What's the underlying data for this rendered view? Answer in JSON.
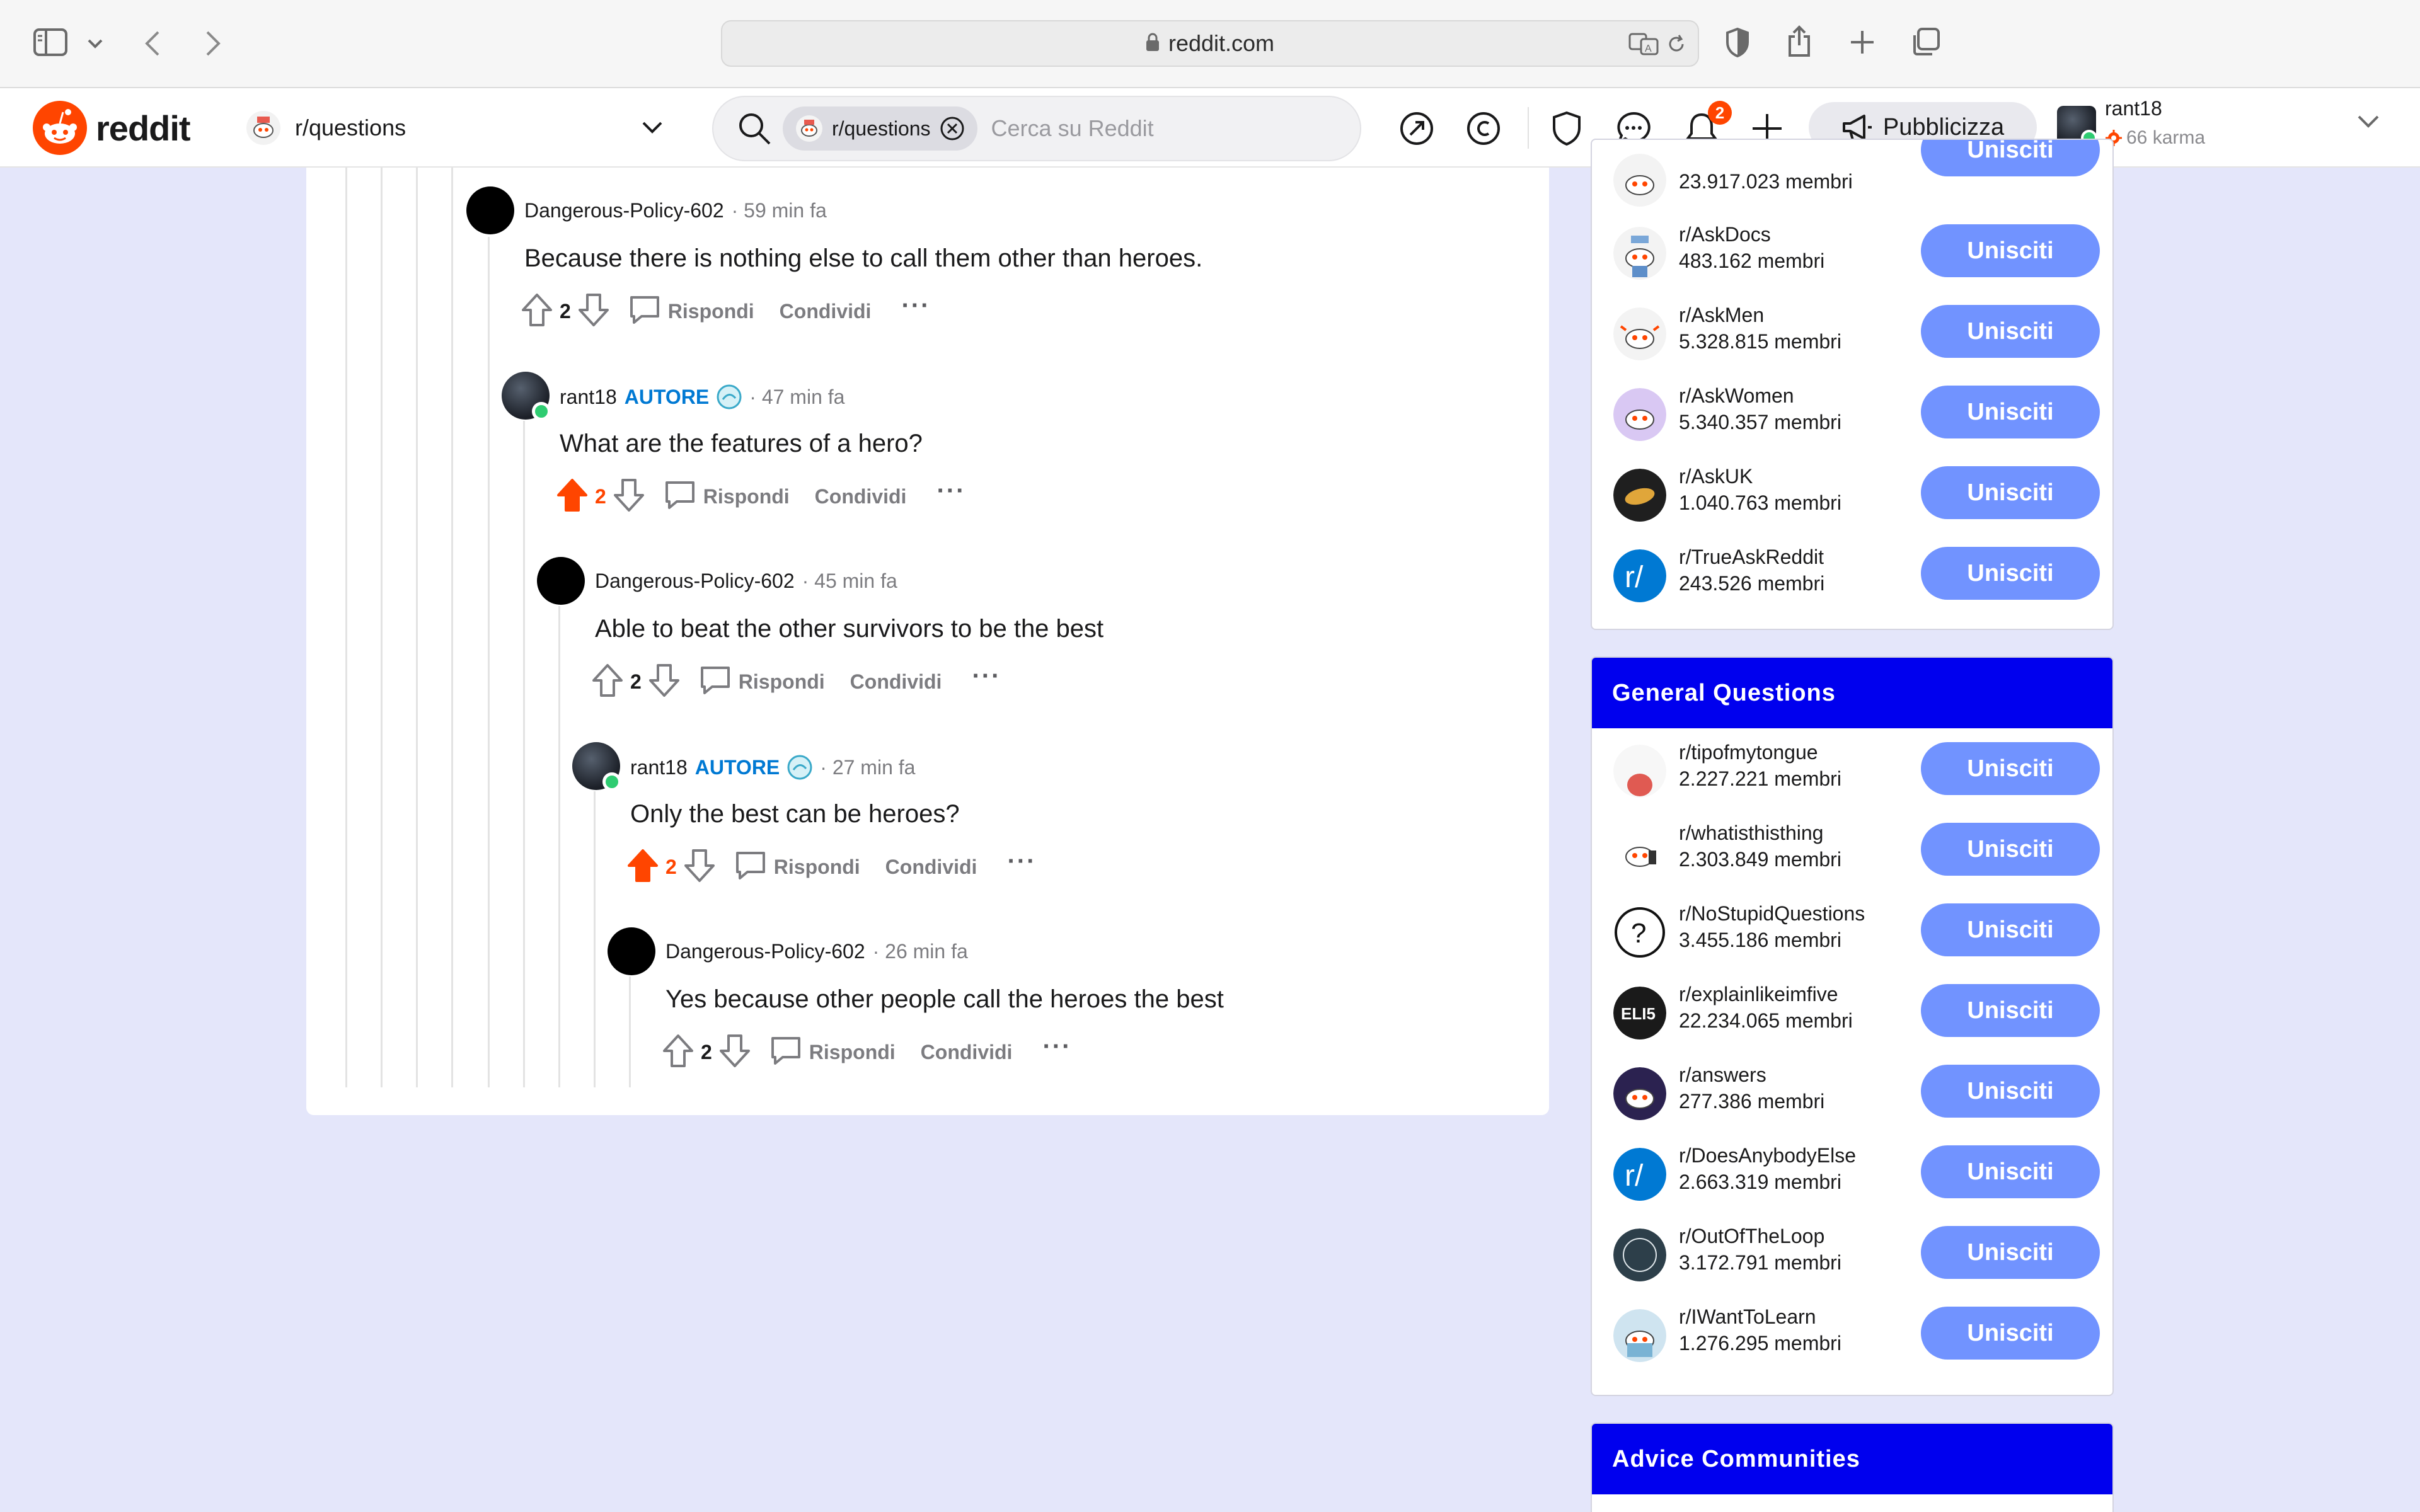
{
  "browser": {
    "url": "reddit.com"
  },
  "header": {
    "wordmark": "reddit",
    "community": "r/questions",
    "search_chip": "r/questions",
    "search_placeholder": "Cerca su Reddit",
    "notifications_count": "2",
    "advertise_label": "Pubblicizza",
    "user_name": "rant18",
    "user_karma": "66 karma"
  },
  "comments": [
    {
      "author": "Dangerous-Policy-602",
      "op": "",
      "time": "· 59 min fa",
      "body": "Because there is nothing else to call them other than heroes.",
      "votes": "2",
      "upvoted": false
    },
    {
      "author": "rant18",
      "op": "AUTORE",
      "time": "· 47 min fa",
      "body": "What are the features of a hero?",
      "votes": "2",
      "upvoted": true
    },
    {
      "author": "Dangerous-Policy-602",
      "op": "",
      "time": "· 45 min fa",
      "body": "Able to beat the other survivors to be the best",
      "votes": "2",
      "upvoted": false
    },
    {
      "author": "rant18",
      "op": "AUTORE",
      "time": "· 27 min fa",
      "body": "Only the best can be heroes?",
      "votes": "2",
      "upvoted": true
    },
    {
      "author": "Dangerous-Policy-602",
      "op": "",
      "time": "· 26 min fa",
      "body": "Yes because other people call the heroes the best",
      "votes": "2",
      "upvoted": false
    }
  ],
  "actions": {
    "reply": "Rispondi",
    "share": "Condividi",
    "more": "···"
  },
  "sidebar": {
    "join_label": "Unisciti",
    "top_partial_members": "23.917.023 membri",
    "ask_communities": [
      {
        "name": "r/AskDocs",
        "members": "483.162 membri",
        "icon": "askdocs-icon"
      },
      {
        "name": "r/AskMen",
        "members": "5.328.815 membri",
        "icon": "askmen-icon"
      },
      {
        "name": "r/AskWomen",
        "members": "5.340.357 membri",
        "icon": "askwomen-icon"
      },
      {
        "name": "r/AskUK",
        "members": "1.040.763 membri",
        "icon": "askuk-icon"
      },
      {
        "name": "r/TrueAskReddit",
        "members": "243.526 membri",
        "icon": "r-slash-icon"
      }
    ],
    "general_title": "General Questions",
    "general": [
      {
        "name": "r/tipofmytongue",
        "members": "2.227.221 membri",
        "icon": "tongue-icon"
      },
      {
        "name": "r/whatisthisthing",
        "members": "2.303.849 membri",
        "icon": "snoo-icon"
      },
      {
        "name": "r/NoStupidQuestions",
        "members": "3.455.186 membri",
        "icon": "question-mark-icon"
      },
      {
        "name": "r/explainlikeimfive",
        "members": "22.234.065 membri",
        "icon": "eli5-icon",
        "icon_text": "ELI5"
      },
      {
        "name": "r/answers",
        "members": "277.386 membri",
        "icon": "answers-icon"
      },
      {
        "name": "r/DoesAnybodyElse",
        "members": "2.663.319 membri",
        "icon": "r-slash-icon"
      },
      {
        "name": "r/OutOfTheLoop",
        "members": "3.172.791 membri",
        "icon": "outoftheloop-icon"
      },
      {
        "name": "r/IWantToLearn",
        "members": "1.276.295 membri",
        "icon": "learn-icon"
      }
    ],
    "advice_title": "Advice Communities"
  },
  "colors": {
    "page_bg": "#e4e6fa",
    "sidebar_header": "#0000ee",
    "join_button": "#7193ff",
    "op_tag": "#0079d3",
    "upvote": "#ff4500"
  }
}
